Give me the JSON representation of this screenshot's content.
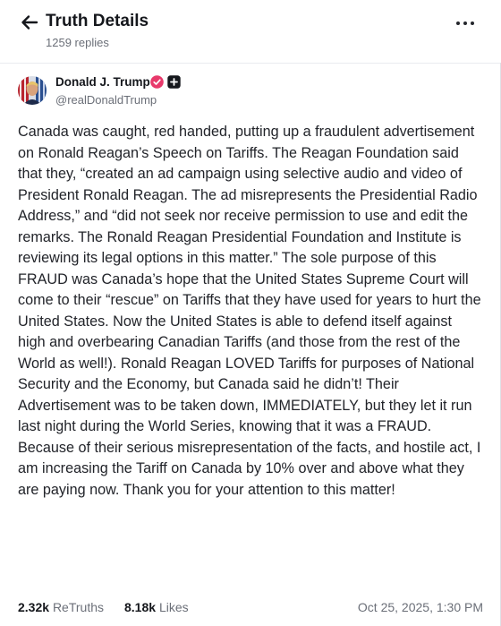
{
  "header": {
    "title": "Truth Details",
    "subtitle": "1259 replies"
  },
  "author": {
    "name": "Donald J. Trump",
    "handle": "@realDonaldTrump"
  },
  "post": {
    "text": "Canada was caught, red handed, putting up a fraudulent advertisement on Ronald Reagan’s Speech on Tariffs. The Reagan Foundation said that they, “created an ad campaign using selective audio and video of President Ronald Reagan. The ad misrepresents the Presidential Radio Address,” and “did not seek nor receive permission to use and edit the remarks. The Ronald Reagan Presidential Foundation and Institute is reviewing its legal options in this matter.” The sole purpose of this FRAUD was Canada’s hope that the United States Supreme Court will come to their “rescue” on Tariffs that they have used for years to hurt the United States. Now the United States is able to defend itself against high and overbearing Canadian Tariffs (and those from the rest of the World as well!). Ronald Reagan LOVED Tariffs for purposes of National Security and the Economy, but Canada said he didn’t! Their Advertisement was to be taken down, IMMEDIATELY, but they let it run last night during the World Series, knowing that it was a FRAUD. Because of their serious misrepresentation of the facts, and hostile act, I am increasing the Tariff on Canada by 10% over and above what they are paying now. Thank you for your attention to this matter!"
  },
  "footer": {
    "retruths_count": "2.32k",
    "retruths_label": "ReTruths",
    "likes_count": "8.18k",
    "likes_label": "Likes",
    "date": "Oct 25, 2025, 1:30 PM"
  },
  "icons": {
    "back": "arrow-left-icon",
    "more": "more-horizontal-icon",
    "verified": "verified-badge-icon",
    "plus": "plus-badge-icon"
  },
  "colors": {
    "verified_badge": "#e8396b",
    "text_primary": "#15171c",
    "text_secondary": "#6b6f78"
  }
}
